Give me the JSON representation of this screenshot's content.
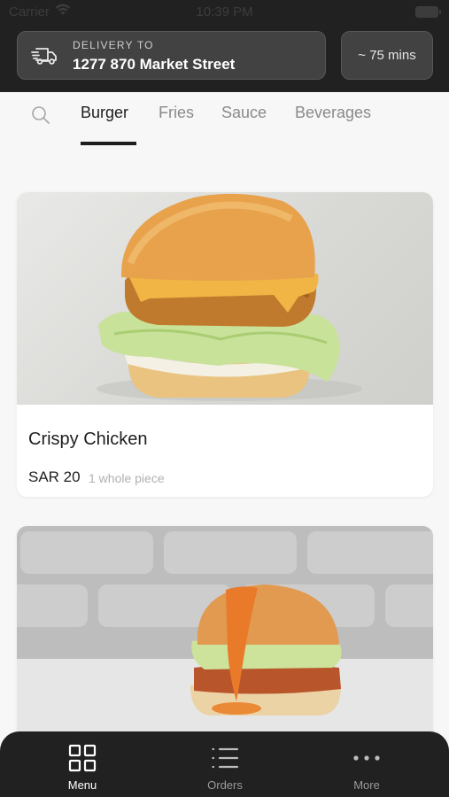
{
  "status_bar": {
    "carrier": "Carrier",
    "time": "10:39 PM"
  },
  "header": {
    "delivery_label": "DELIVERY TO",
    "address": "1277 870 Market Street",
    "eta": "~ 75 mins"
  },
  "tabs": {
    "items": [
      {
        "label": "Burger",
        "active": true
      },
      {
        "label": "Fries",
        "active": false
      },
      {
        "label": "Sauce",
        "active": false
      },
      {
        "label": "Beverages",
        "active": false
      }
    ]
  },
  "products": [
    {
      "name": "Crispy Chicken",
      "price": "SAR 20",
      "portion": "1 whole piece"
    },
    {
      "name": "",
      "price": "",
      "portion": ""
    }
  ],
  "bottom_nav": {
    "items": [
      {
        "label": "Menu",
        "icon": "grid-icon",
        "active": true
      },
      {
        "label": "Orders",
        "icon": "list-icon",
        "active": false
      },
      {
        "label": "More",
        "icon": "more-dots-icon",
        "active": false
      }
    ]
  },
  "colors": {
    "dark": "#212121",
    "accent_text": "#1e1e1e",
    "inactive_text": "#8a8a8a"
  }
}
